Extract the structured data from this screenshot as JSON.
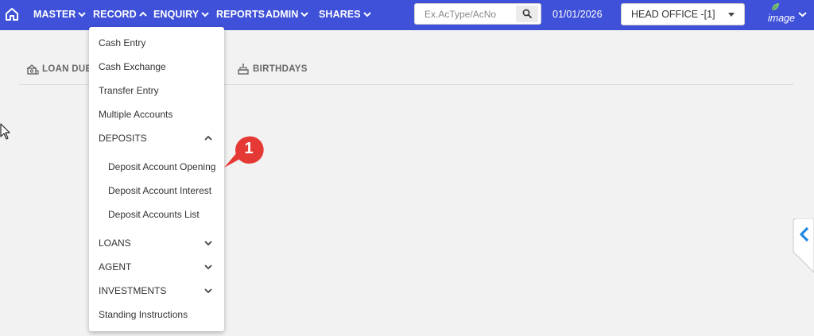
{
  "nav": {
    "items": [
      {
        "label": "MASTER",
        "has_dropdown": true,
        "expanded": false
      },
      {
        "label": "RECORD",
        "has_dropdown": true,
        "expanded": true
      },
      {
        "label": "ENQUIRY",
        "has_dropdown": true,
        "expanded": false
      },
      {
        "label": "REPORTS",
        "has_dropdown": false
      },
      {
        "label": "ADMIN",
        "has_dropdown": true,
        "expanded": false
      },
      {
        "label": "SHARES",
        "has_dropdown": true,
        "expanded": false
      }
    ],
    "search": {
      "placeholder": "Ex.AcType/AcNo",
      "value": ""
    },
    "date": "01/01/2026",
    "branch": "HEAD OFFICE -[1]",
    "avatar_alt": "image",
    "color": "#3f51d8"
  },
  "tabs": [
    {
      "label": "LOAN DUE"
    },
    {
      "label": "BIRTHDAYS"
    }
  ],
  "record_menu": {
    "items": [
      {
        "label": "Cash Entry"
      },
      {
        "label": "Cash Exchange"
      },
      {
        "label": "Transfer Entry"
      },
      {
        "label": "Multiple Accounts"
      },
      {
        "label": "DEPOSITS",
        "group": true,
        "expanded": true
      },
      {
        "label": "Deposit Account Opening",
        "sub": true
      },
      {
        "label": "Deposit Account Interest",
        "sub": true
      },
      {
        "label": "Deposit Accounts List",
        "sub": true
      },
      {
        "label": "LOANS",
        "group": true,
        "expanded": false
      },
      {
        "label": "AGENT",
        "group": true,
        "expanded": false
      },
      {
        "label": "INVESTMENTS",
        "group": true,
        "expanded": false
      },
      {
        "label": "Standing Instructions"
      }
    ]
  },
  "callout": {
    "number": "1",
    "color": "#e53935"
  },
  "icons": [
    "home-icon",
    "search-icon",
    "chevron-down-icon",
    "chevron-up-icon",
    "loan-icon",
    "cake-icon",
    "chevron-left-icon",
    "mouse-cursor-icon"
  ]
}
